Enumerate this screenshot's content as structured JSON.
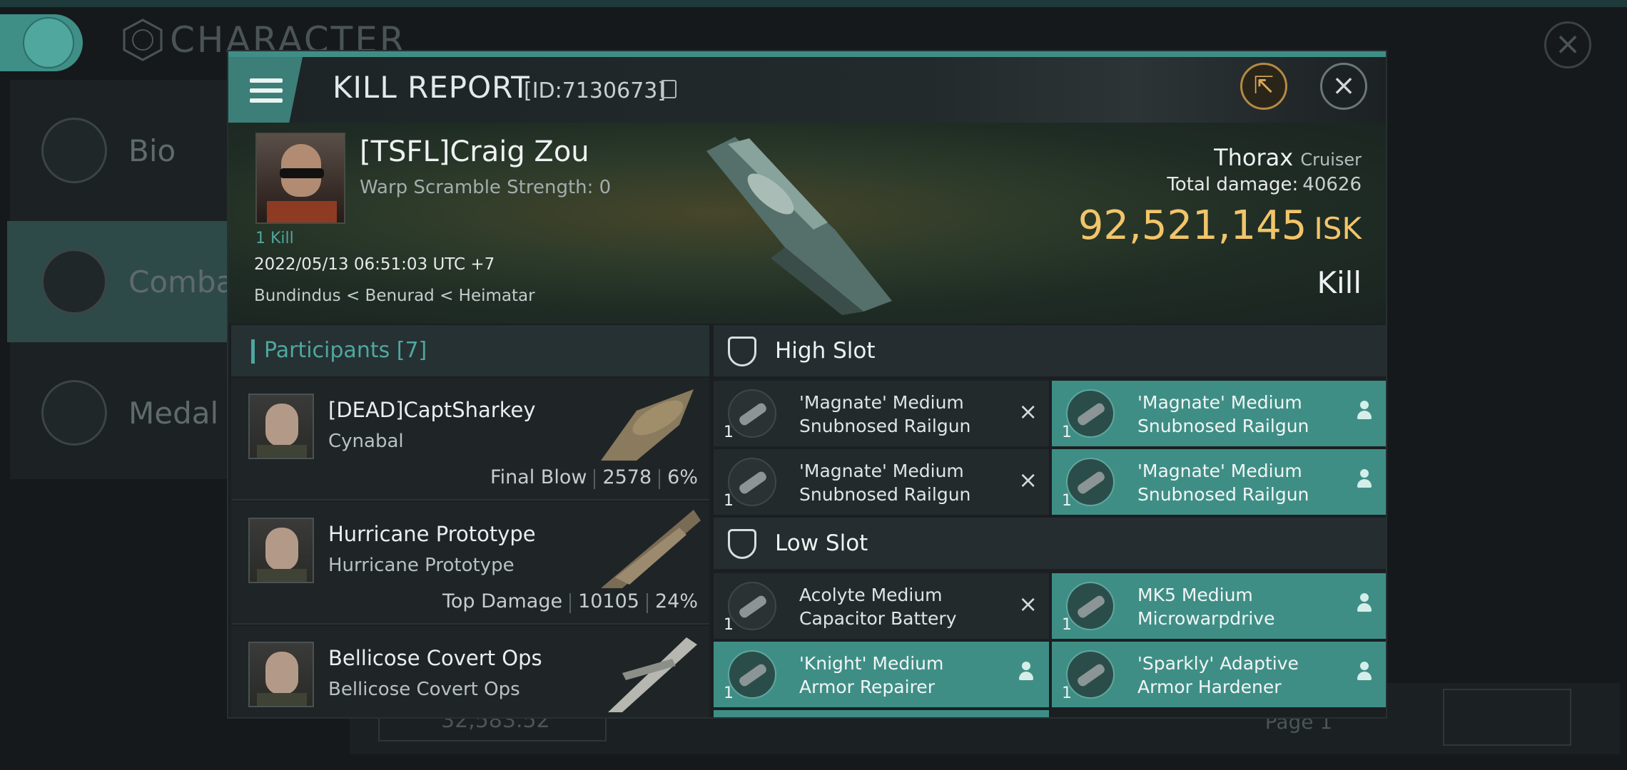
{
  "background": {
    "title": "CHARACTER",
    "menu_items": [
      {
        "label": "Bio"
      },
      {
        "label": "Comba"
      },
      {
        "label": "Medal"
      }
    ],
    "search_value": "32,583.52",
    "page_label": "Page 1"
  },
  "modal": {
    "title": "KILL REPORT",
    "id_label": "[ID:7130673]",
    "victim": {
      "name": "[TSFL]Craig Zou",
      "warp_scramble": "Warp Scramble Strength: 0",
      "kills": "1 Kill",
      "datetime": "2022/05/13 06:51:03 UTC +7",
      "location": "Bundindus < Benurad < Heimatar",
      "ship_name": "Thorax",
      "ship_class": "Cruiser",
      "total_damage_label": "Total damage:",
      "total_damage": "40626",
      "isk_value": "92,521,145",
      "isk_unit": "ISK",
      "result": "Kill"
    },
    "participants": {
      "header": "Participants [7]",
      "rows": [
        {
          "name": "[DEAD]CaptSharkey",
          "ship": "Cynabal",
          "tag": "Final Blow",
          "damage": "2578",
          "percent": "6%"
        },
        {
          "name": "Hurricane Prototype",
          "ship": "Hurricane Prototype",
          "tag": "Top Damage",
          "damage": "10105",
          "percent": "24%"
        },
        {
          "name": "Bellicose Covert Ops",
          "ship": "Bellicose Covert Ops",
          "tag": "",
          "damage": "",
          "percent": ""
        }
      ]
    },
    "slots": {
      "high_title": "High Slot",
      "high": [
        {
          "line1": "'Magnate' Medium",
          "line2": "Snubnosed Railgun",
          "qty": "1",
          "state": "destroyed"
        },
        {
          "line1": "'Magnate' Medium",
          "line2": "Snubnosed Railgun",
          "qty": "1",
          "state": "dropped"
        },
        {
          "line1": "'Magnate' Medium",
          "line2": "Snubnosed Railgun",
          "qty": "1",
          "state": "destroyed"
        },
        {
          "line1": "'Magnate' Medium",
          "line2": "Snubnosed Railgun",
          "qty": "1",
          "state": "dropped"
        }
      ],
      "low_title": "Low Slot",
      "low": [
        {
          "line1": "Acolyte Medium",
          "line2": "Capacitor Battery",
          "qty": "1",
          "state": "destroyed"
        },
        {
          "line1": "MK5 Medium",
          "line2": "Microwarpdrive",
          "qty": "1",
          "state": "dropped"
        },
        {
          "line1": "'Knight' Medium",
          "line2": "Armor Repairer",
          "qty": "1",
          "state": "dropped"
        },
        {
          "line1": "'Sparkly' Adaptive",
          "line2": "Armor Hardener",
          "qty": "1",
          "state": "dropped"
        }
      ]
    }
  },
  "colors": {
    "accent": "#3f8e86",
    "isk": "#f2c56a",
    "teal_text": "#4fa79e"
  }
}
